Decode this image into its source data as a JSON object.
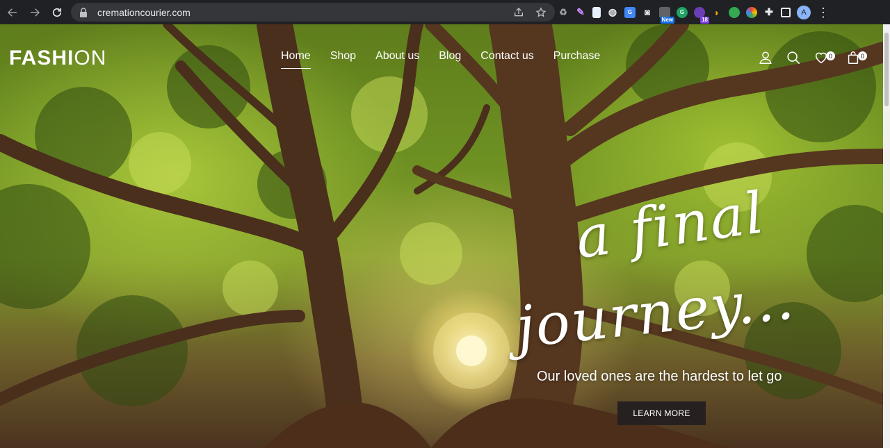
{
  "browser": {
    "url": "cremationcourier.com",
    "extension_badges": {
      "new": "New",
      "count": "18"
    },
    "profile_initial": "A"
  },
  "site": {
    "logo_bold": "FASHI",
    "logo_thin": "ON",
    "nav": [
      {
        "label": "Home",
        "active": true
      },
      {
        "label": "Shop"
      },
      {
        "label": "About us"
      },
      {
        "label": "Blog"
      },
      {
        "label": "Contact us"
      },
      {
        "label": "Purchase"
      }
    ],
    "wishlist_count": "0",
    "cart_count": "0"
  },
  "hero": {
    "script_line1": "a final",
    "script_line2": "journey...",
    "subtitle": "Our loved ones are the hardest to let go",
    "button": "LEARN MORE"
  },
  "colors": {
    "chrome_bg": "#202124",
    "omnibox_bg": "#35363a",
    "button_bg": "#262120",
    "foliage": "#8fb52e",
    "bark": "#5a3a22"
  },
  "icons": [
    "back-arrow-icon",
    "forward-arrow-icon",
    "reload-icon",
    "lock-icon",
    "share-icon",
    "star-icon",
    "user-icon",
    "search-icon",
    "heart-icon",
    "bag-icon"
  ]
}
